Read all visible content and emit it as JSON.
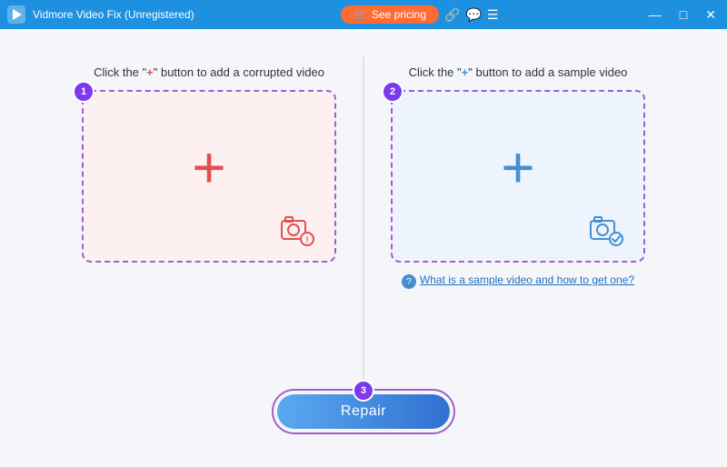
{
  "titleBar": {
    "appName": "Vidmore Video Fix (Unregistered)",
    "seePricingLabel": "See pricing",
    "icons": {
      "link": "🔗",
      "chat": "💬",
      "menu": "☰",
      "minimize": "—",
      "maximize": "□",
      "close": "✕"
    }
  },
  "panels": {
    "left": {
      "instruction": "Click the \"+\" button to add a corrupted video",
      "plusChar": "+",
      "stepNumber": "1",
      "altText": "Add corrupted video"
    },
    "right": {
      "instruction": "Click the \"+\" button to add a sample video",
      "plusChar": "+",
      "stepNumber": "2",
      "altText": "Add sample video",
      "helpText": "What is a sample video and how to get one?"
    }
  },
  "repair": {
    "stepNumber": "3",
    "label": "Repair"
  }
}
